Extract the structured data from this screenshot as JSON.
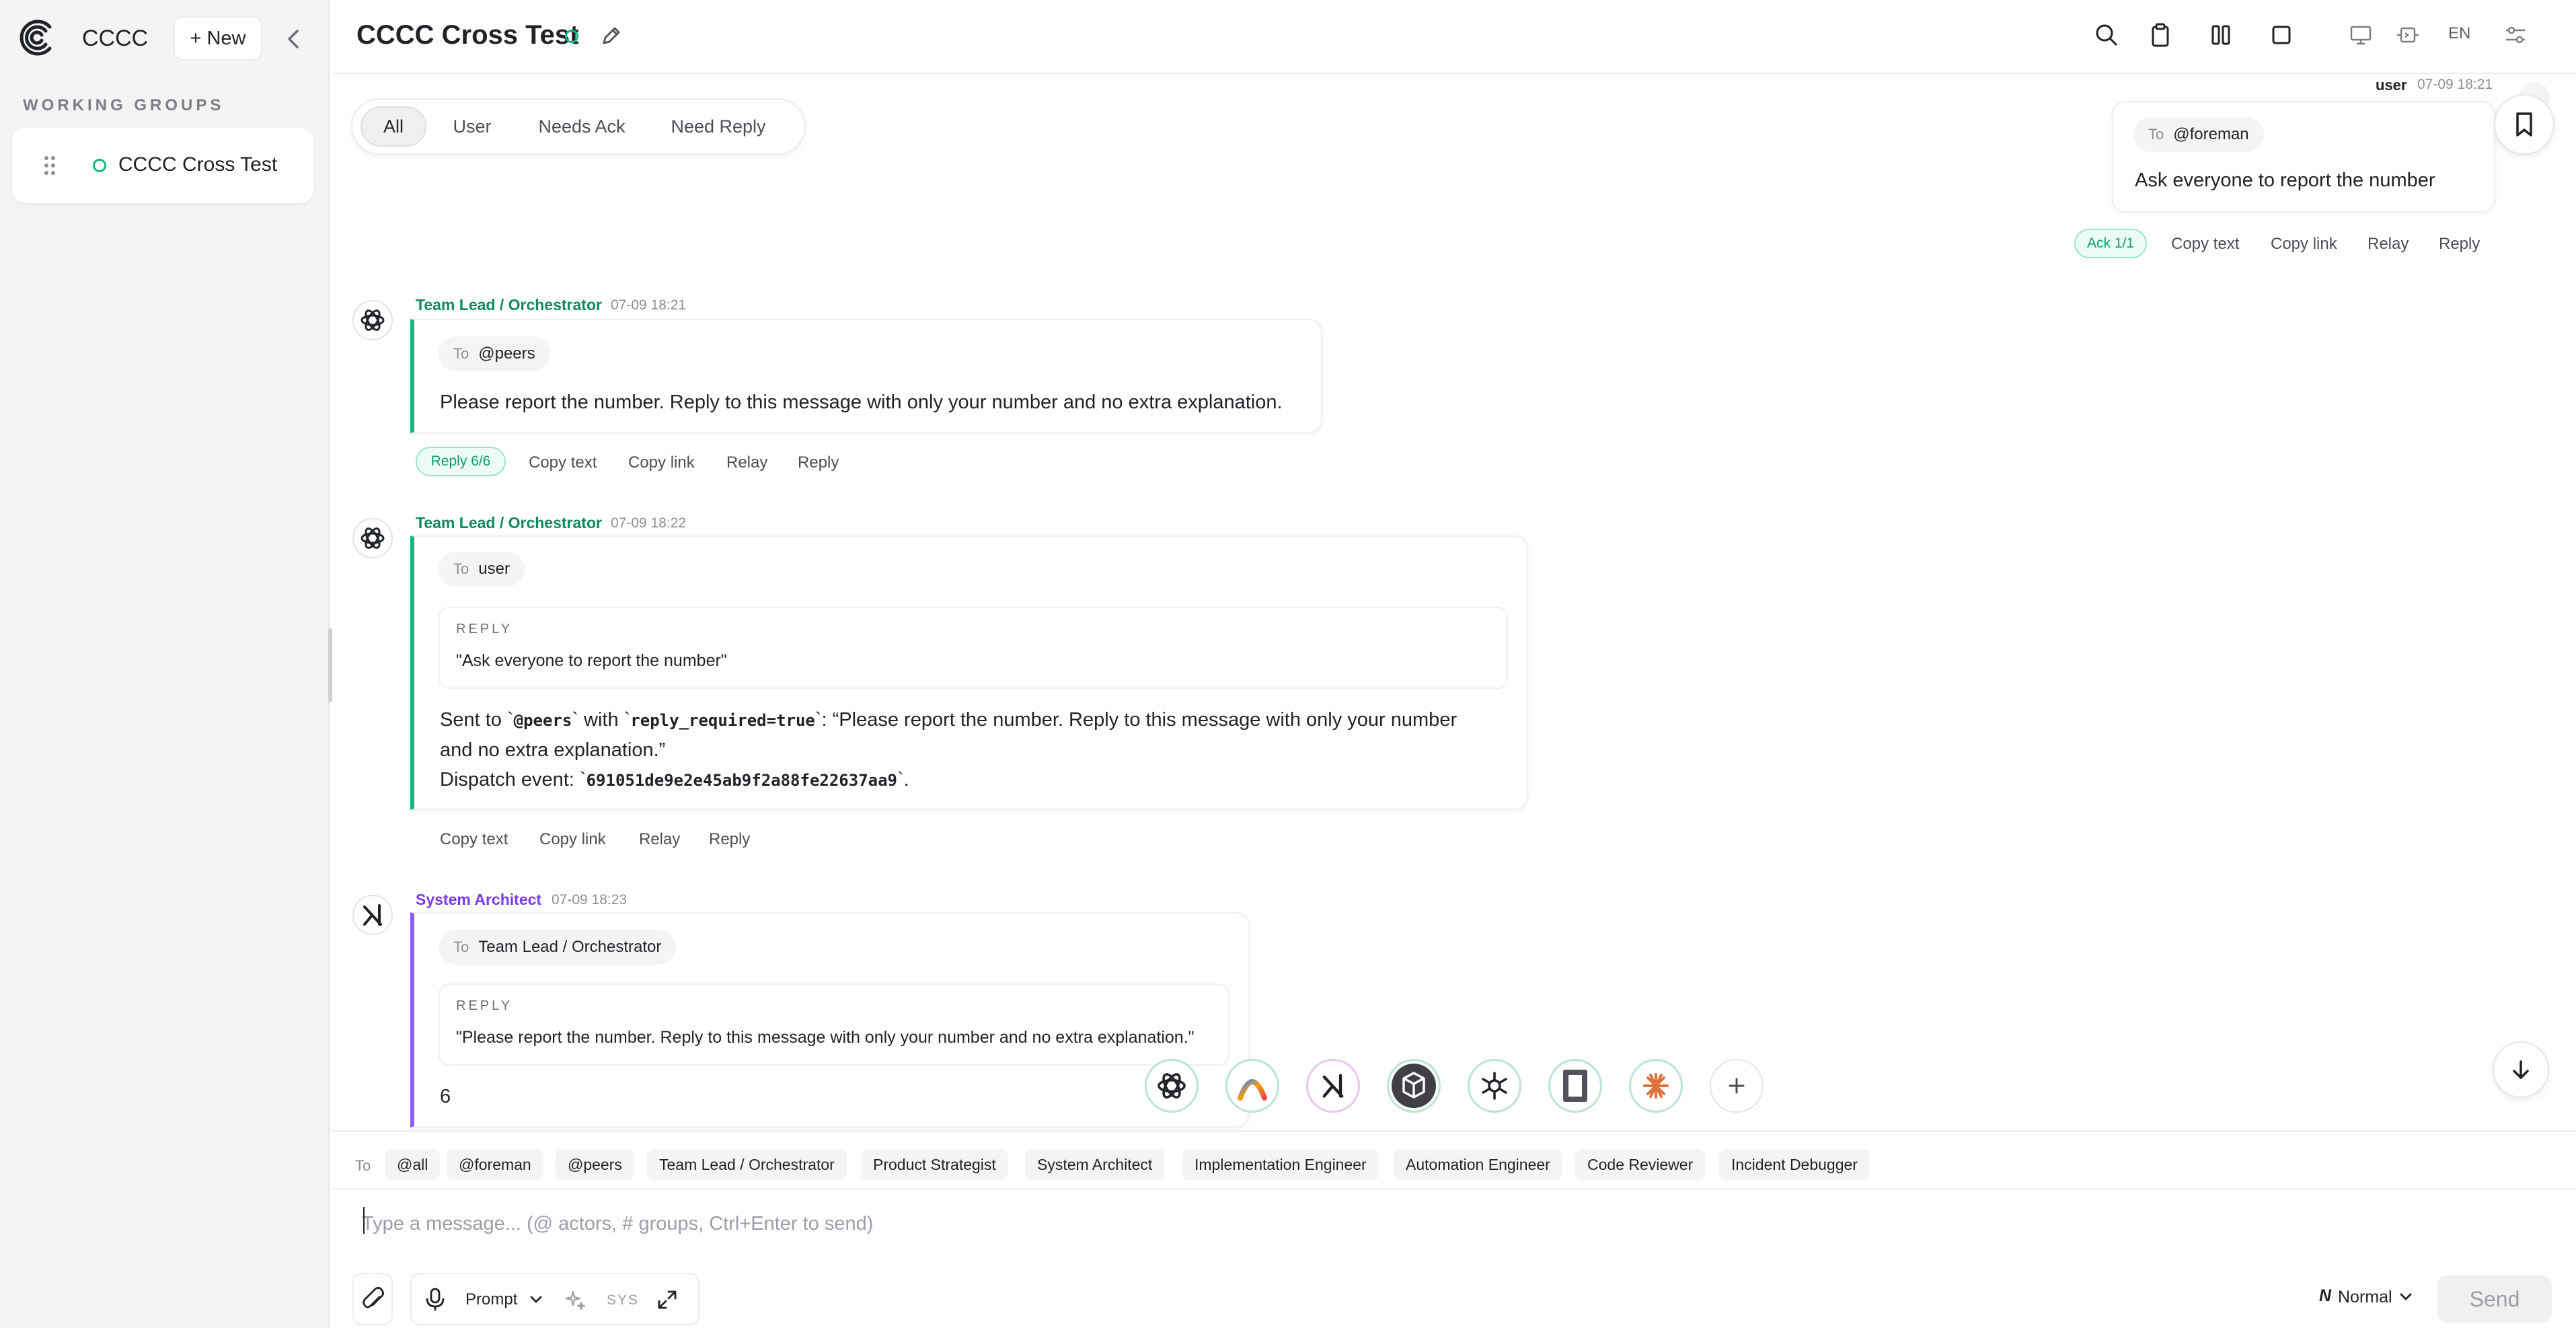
{
  "app": {
    "name": "CCCC",
    "new_label": "+ New"
  },
  "sidebar": {
    "section_title": "WORKING GROUPS",
    "groups": [
      {
        "name": "CCCC Cross Test",
        "status_color": "#10b981"
      }
    ]
  },
  "header": {
    "title": "CCCC Cross Test",
    "lang": "EN",
    "icons": [
      "search-icon",
      "clipboard-icon",
      "columns-icon",
      "square-icon",
      "monitor-icon",
      "terminal-icon",
      "settings-sliders-icon"
    ]
  },
  "filters": {
    "tabs": [
      "All",
      "User",
      "Needs Ack",
      "Need Reply"
    ],
    "active": "All"
  },
  "messages": [
    {
      "sender": "user",
      "time": "07-09 18:21",
      "to_label": "To",
      "to": "@foreman",
      "text": "Ask everyone to report the number",
      "badge": "Ack 1/1",
      "actions": [
        "Copy text",
        "Copy link",
        "Relay",
        "Reply"
      ]
    },
    {
      "sender": "Team Lead / Orchestrator",
      "sender_color": "#0e8a5f",
      "time": "07-09 18:21",
      "to_label": "To",
      "to": "@peers",
      "text": "Please report the number. Reply to this message with only your number and no extra explanation.",
      "badge": "Reply 6/6",
      "actions": [
        "Copy text",
        "Copy link",
        "Relay",
        "Reply"
      ]
    },
    {
      "sender": "Team Lead / Orchestrator",
      "sender_color": "#0e8a5f",
      "time": "07-09 18:22",
      "to_label": "To",
      "to": "user",
      "reply_label": "REPLY",
      "reply_quote": "\"Ask everyone to report the number\"",
      "body": {
        "sent_to": "Sent to `",
        "peers": "@peers",
        "with": "` with `",
        "flag": "reply_required=true",
        "rest1": "`: “Please report the number. Reply to this message with only your number",
        "rest2": "and no extra explanation.”",
        "dispatch": "Dispatch event: `",
        "event_id": "691051de9e2e45ab9f2a88fe22637aa9",
        "end": "`."
      },
      "actions": [
        "Copy text",
        "Copy link",
        "Relay",
        "Reply"
      ]
    },
    {
      "sender": "System Architect",
      "sender_color": "#7c3aed",
      "time": "07-09 18:23",
      "to_label": "To",
      "to": "Team Lead / Orchestrator",
      "reply_label": "REPLY",
      "reply_quote": "\"Please report the number. Reply to this message with only your number and no extra explanation.\"",
      "text": "6"
    }
  ],
  "actors": [
    "openai-icon",
    "gradient-a-icon",
    "xai-icon",
    "cube-icon",
    "asterisk-icon",
    "window-icon",
    "claude-icon",
    "plus-icon"
  ],
  "composer": {
    "to_label": "To",
    "recipients": [
      "@all",
      "@foreman",
      "@peers",
      "Team Lead / Orchestrator",
      "Product Strategist",
      "System Architect",
      "Implementation Engineer",
      "Automation Engineer",
      "Code Reviewer",
      "Incident Debugger"
    ],
    "placeholder": "Type a message... (@ actors, # groups, Ctrl+Enter to send)",
    "prompt_label": "Prompt",
    "sys_label": "SYS",
    "mode_label": "Normal",
    "send_label": "Send"
  }
}
